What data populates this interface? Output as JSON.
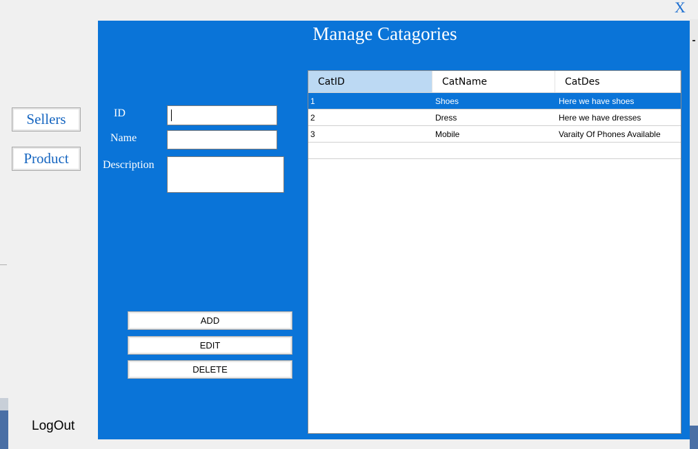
{
  "window": {
    "close_label": "X"
  },
  "sidebar": {
    "sellers_label": "Sellers",
    "product_label": "Product",
    "logout_label": "LogOut"
  },
  "panel": {
    "title": "Manage Catagories",
    "background": "#0a74d8"
  },
  "form": {
    "id_label": "ID",
    "name_label": "Name",
    "description_label": "Description",
    "id_value": "",
    "name_value": "",
    "description_value": ""
  },
  "actions": {
    "add_label": "ADD",
    "edit_label": "EDIT",
    "delete_label": "DELETE"
  },
  "grid": {
    "columns": [
      "CatID",
      "CatName",
      "CatDes"
    ],
    "rows": [
      {
        "id": "1",
        "name": "Shoes",
        "des": "Here we have shoes",
        "selected": true
      },
      {
        "id": "2",
        "name": "Dress",
        "des": "Here we have dresses",
        "selected": false
      },
      {
        "id": "3",
        "name": "Mobile",
        "des": "Varaity Of Phones Available",
        "selected": false
      }
    ],
    "selection_color": "#0a74d8",
    "header_highlight": "#bcd9f3"
  }
}
